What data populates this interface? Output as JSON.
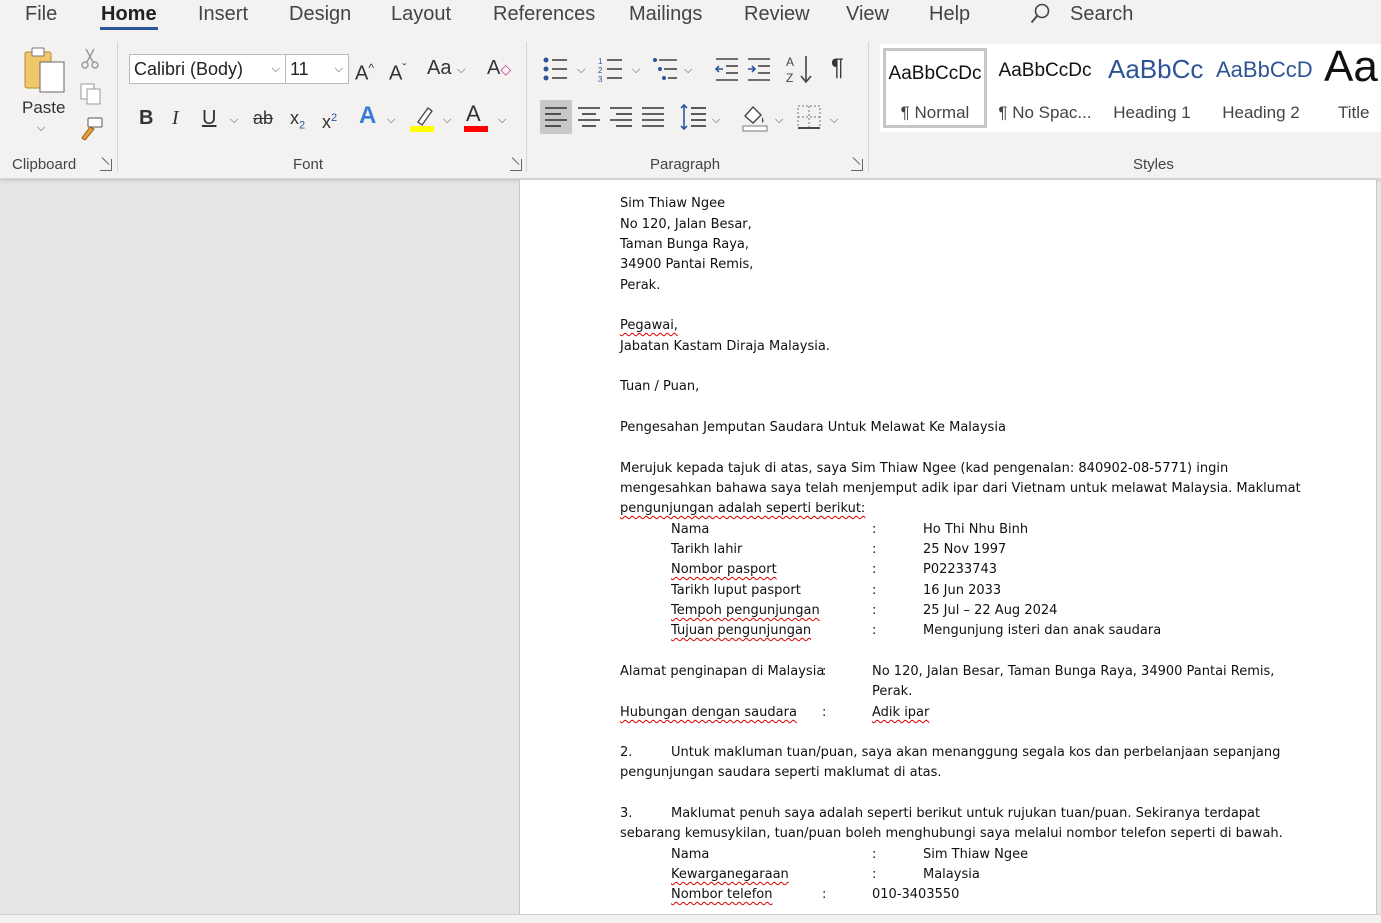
{
  "tabs": [
    "File",
    "Home",
    "Insert",
    "Design",
    "Layout",
    "References",
    "Mailings",
    "Review",
    "View",
    "Help"
  ],
  "search": {
    "label": "Search",
    "icon": "search-icon"
  },
  "clipboard": {
    "paste": "Paste",
    "group": "Clipboard"
  },
  "font": {
    "name": "Calibri (Body)",
    "size": "11",
    "group": "Font",
    "grow": "A^",
    "shrink": "A˅",
    "case": "Aa",
    "bold": "B",
    "italic": "I",
    "underline": "U",
    "strike": "ab",
    "sub": "x",
    "sup": "x",
    "sub_mark": "2",
    "sup_mark": "2",
    "effects": "A",
    "color": "A"
  },
  "paragraph": {
    "group": "Paragraph",
    "pilcrow": "¶"
  },
  "styles": {
    "group": "Styles",
    "items": [
      {
        "sample": "AaBbCcDc",
        "name": "¶ Normal"
      },
      {
        "sample": "AaBbCcDc",
        "name": "¶ No Spac..."
      },
      {
        "sample": "AaBbCc",
        "name": "Heading 1"
      },
      {
        "sample": "AaBbCcD",
        "name": "Heading 2"
      },
      {
        "sample": "Aa",
        "name": "Title"
      }
    ]
  },
  "colors": {
    "accent": "#2b579a",
    "highlight": "#ffff00",
    "font_color": "#ff0000",
    "heading": "#2f5496"
  },
  "document": {
    "address": [
      "Sim Thiaw Ngee",
      "No 120, Jalan Besar,",
      "Taman Bunga Raya,",
      "34900 Pantai Remis,",
      "Perak."
    ],
    "to": [
      "Pegawai,",
      "Jabatan Kastam Diraja Malaysia."
    ],
    "salutation": "Tuan / Puan,",
    "subject": "Pengesahan Jemputan Saudara Untuk Melawat Ke Malaysia",
    "para1": [
      "Merujuk kepada tajuk di atas, saya Sim Thiaw Ngee (kad pengenalan: 840902-08-5771) ingin",
      "mengesahkan bahawa saya telah menjemput adik ipar dari Vietnam untuk melawat Malaysia. Maklumat",
      "pengunjungan adalah seperti berikut:"
    ],
    "visitor": [
      {
        "label": "Nama",
        "value": "Ho Thi Nhu Binh"
      },
      {
        "label": "Tarikh lahir",
        "value": "25 Nov 1997"
      },
      {
        "label": "Nombor pasport",
        "value": "P02233743"
      },
      {
        "label": "Tarikh luput pasport",
        "value": "16 Jun 2033"
      },
      {
        "label": "Tempoh pengunjungan",
        "value": "25 Jul – 22 Aug 2024"
      },
      {
        "label": "Tujuan pengunjungan",
        "value": "Mengunjung isteri dan anak saudara"
      }
    ],
    "colon": ":",
    "stay_label": "Alamat penginapan di Malaysia",
    "stay_value": [
      "No 120, Jalan Besar, Taman Bunga Raya, 34900 Pantai Remis,",
      "Perak."
    ],
    "relation_label": "Hubungan dengan saudara",
    "relation_value": "Adik ipar",
    "p2_num": "2.",
    "p2": [
      "Untuk makluman tuan/puan, saya akan menanggung segala kos dan perbelanjaan sepanjang",
      "pengunjungan saudara seperti maklumat di atas."
    ],
    "p3_num": "3.",
    "p3": [
      "Maklumat penuh saya adalah seperti berikut untuk rujukan tuan/puan. Sekiranya terdapat",
      "sebarang kemusykilan, tuan/puan boleh menghubungi saya melalui nombor telefon seperti di bawah."
    ],
    "host": [
      {
        "label": "Nama",
        "value": "Sim Thiaw Ngee"
      },
      {
        "label": "Kewarganegaraan",
        "value": "Malaysia"
      },
      {
        "label": "Nombor telefon",
        "value": "010-3403550"
      }
    ]
  }
}
